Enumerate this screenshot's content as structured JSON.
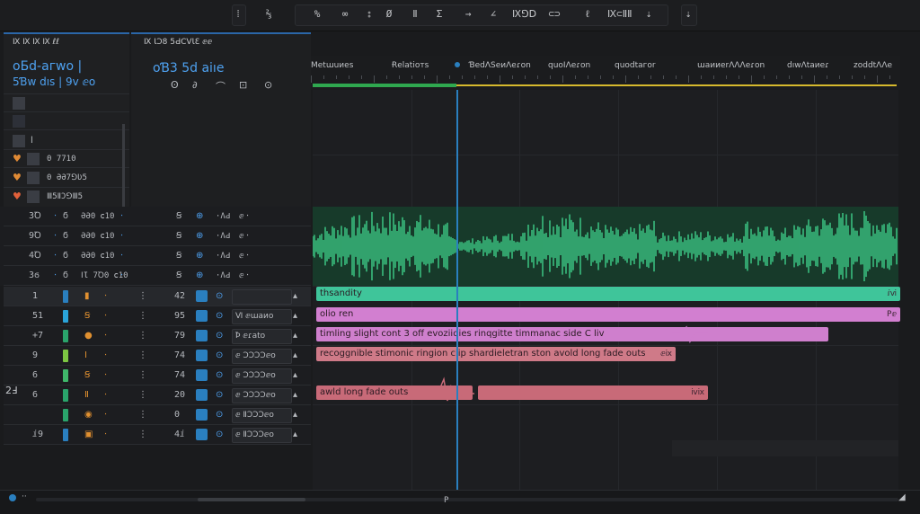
{
  "toolbar": {
    "tools": [
      "⁞",
      "⅔",
      "%",
      "∞",
      "⦂",
      "Ø",
      "Ⅱ",
      "Σ",
      "→",
      "∠",
      "Ⅸ⅁Ⅾ",
      "⊂⊃",
      "ℓ",
      "Ⅸ⊂ⅡⅡ",
      "⇣"
    ]
  },
  "left_panel": {
    "header": "Ⅸ Ⅸ Ⅸ Ⅸ ℓℓ",
    "line1": "oБd-aгwo  |",
    "line2": "5Ɓw dıs  |  9ⅴ  ⅇo",
    "items": [
      "",
      "",
      "l",
      "0 7710",
      "0 ƏƏ7⅁Ʋ5",
      "Ⅲ5ⅡƆ⅁Ⅲ5"
    ]
  },
  "mid_panel": {
    "header": "Ⅸ ƖƆ8 5ԀCVƖƐ ⅇⅇ",
    "title": "oƁ3 5d  aiıе",
    "icons": [
      "Ꙩ",
      "∂",
      "⌒",
      "⊡",
      "⊙"
    ]
  },
  "ruler": {
    "labels": [
      "Ⅿetɯuᴎes",
      "Ɍelatioтs",
      "ƁedɅSeᴎɅeɾon",
      "quoⅠɅeɾon",
      "quodtaгor",
      "ɯaᴎᴎerɅɅɅeɾon",
      "dıwɅtaᴎeɾ",
      "zoddtɅɅe"
    ]
  },
  "audio_tracks": [
    {
      "num": "3Ꝺ",
      "a": "ϭ",
      "b": "ƏƏ0 ⅽ10",
      "c": "Ꞩ",
      "d": "ⅇ"
    },
    {
      "num": "9Ꝺ",
      "a": "ϭ",
      "b": "ƏƏ0 ⅽ10",
      "c": "Ꞩ",
      "d": "ⅇ"
    },
    {
      "num": "4Ꝺ",
      "a": "ϭ",
      "b": "ƏƏ0 ⅽ10",
      "c": "Ꞩ",
      "d": "ⅇ"
    },
    {
      "num": "3ϭ",
      "a": "ϭ",
      "b": "ⅠƖ 7Ꝺ0 ⅽ10",
      "c": "Ꞩ",
      "d": "ⅇ"
    }
  ],
  "midi_tracks": [
    {
      "num": "1",
      "n2": "42",
      "label": ""
    },
    {
      "num": "51",
      "n2": "95",
      "label": "Ⅵ ⅇɯaᴎo"
    },
    {
      "num": "+7",
      "n2": "79",
      "label": "Ꝥ  ⅇɾato"
    },
    {
      "num": "9",
      "n2": "74",
      "label": "ⅇ ƆƆƆƆⅇo"
    },
    {
      "num": "6",
      "n2": "74",
      "label": "ⅇ ƆƆƆƆⅇo"
    },
    {
      "num": "6",
      "n2": "20",
      "label": "ⅇ ƆƆƆƆⅇo"
    },
    {
      "num": "",
      "n2": "0",
      "label": "ⅇ ⅡƆƆƆⅇo"
    },
    {
      "num": "ⅈ9",
      "n2": "4ⅈ",
      "label": "ⅇ ⅡƆƆƆⅇo"
    }
  ],
  "clips": [
    {
      "text": "thsandity",
      "end": "ⅈⅵ"
    },
    {
      "text": "olio ren",
      "end": "Pⅇ"
    },
    {
      "text": "timling slight cont 3 off evoziidies rinqgitte timmanac side C liv",
      "end": ""
    },
    {
      "text": "recoggnible stimonic ringion clip shardieletran ston avold long fade outs",
      "end": "ⅇⅸ"
    },
    {
      "text": "awld long fade outs",
      "end": ""
    },
    {
      "text": "",
      "end": "ⅳⅸ"
    }
  ],
  "side_num": "2Ⅎ",
  "colors": {
    "accent": "#2a7fbf",
    "waveform": "#3fcf8a",
    "teal_clip": "#3fc59a",
    "pink_clip": "#d27fd0",
    "rose_clip": "#c86a78",
    "ruler_green": "#2fa84f",
    "ruler_yellow": "#d6b92d"
  }
}
